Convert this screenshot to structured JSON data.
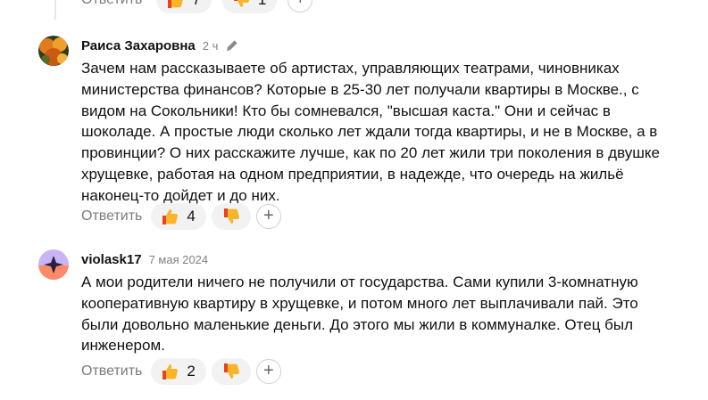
{
  "top": {
    "reply_label": "Ответить",
    "like_count": "7",
    "dislike_count": "1",
    "add_symbol": "+"
  },
  "comments": [
    {
      "author": "Раиса Захаровна",
      "time": "2 ч",
      "edit_icon": "pencil-icon",
      "lines": [
        "Зачем нам рассказываете об артистах, управляющих театрами, чиновниках",
        "министерства финансов? Которые в 25-30 лет получали квартиры в Москве., с",
        "видом на Сокольники! Кто бы сомневался, \"высшая каста.\" Они и сейчас в",
        "шоколаде. А простые люди сколько лет ждали тогда квартиры, и не в Москве, а в",
        "провинции? О них расскажите лучше, как по 20 лет жили три поколения в двушке",
        "хрущевке, работая на одном предприятии, в надежде, что очередь на жильё",
        "наконец-то дойдет и до них."
      ],
      "reply_label": "Ответить",
      "like_count": "4",
      "add_symbol": "+"
    },
    {
      "author": "violask17",
      "time": "7 мая 2024",
      "lines": [
        "А мои родители ничего не получили от государства. Сами купили 3-комнатную",
        "кооперативную квартиру в хрущевке, и потом много лет выплачивали пай. Это",
        "были довольно маленькие деньги. До этого мы жили в коммуналке. Отец был",
        "инженером."
      ],
      "reply_label": "Ответить",
      "like_count": "2",
      "add_symbol": "+"
    }
  ],
  "icons": {
    "like": "thumbs-up-icon",
    "dislike": "thumbs-down-icon"
  },
  "colors": {
    "pill_bg": "#f2f2f2",
    "muted_text": "#7a7a7a",
    "emoji_yellow": "#f7b527",
    "emoji_red": "#e8421e"
  }
}
